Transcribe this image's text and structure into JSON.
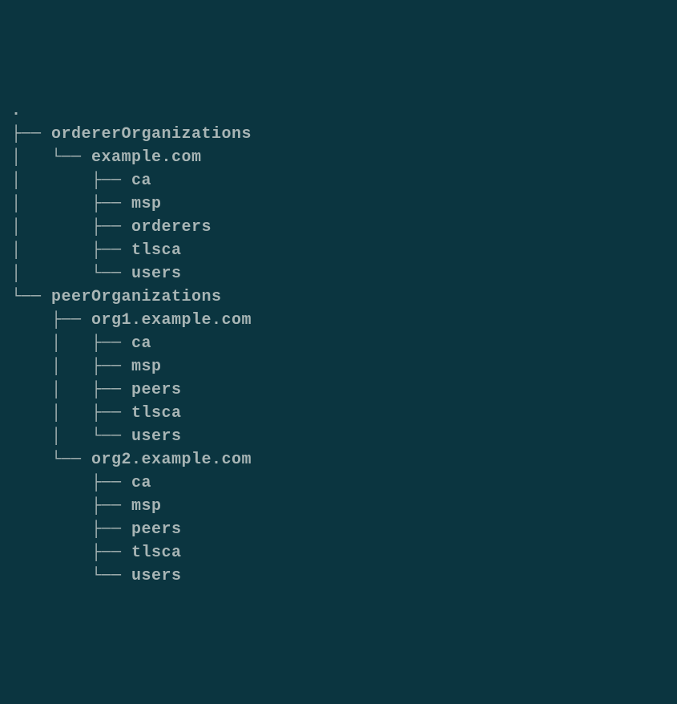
{
  "tree": {
    "root": ".",
    "lines": [
      {
        "prefix": "├── ",
        "name": "ordererOrganizations"
      },
      {
        "prefix": "│   └── ",
        "name": "example.com"
      },
      {
        "prefix": "│       ├── ",
        "name": "ca"
      },
      {
        "prefix": "│       ├── ",
        "name": "msp"
      },
      {
        "prefix": "│       ├── ",
        "name": "orderers"
      },
      {
        "prefix": "│       ├── ",
        "name": "tlsca"
      },
      {
        "prefix": "│       └── ",
        "name": "users"
      },
      {
        "prefix": "└── ",
        "name": "peerOrganizations"
      },
      {
        "prefix": "    ├── ",
        "name": "org1.example.com"
      },
      {
        "prefix": "    │   ├── ",
        "name": "ca"
      },
      {
        "prefix": "    │   ├── ",
        "name": "msp"
      },
      {
        "prefix": "    │   ├── ",
        "name": "peers"
      },
      {
        "prefix": "    │   ├── ",
        "name": "tlsca"
      },
      {
        "prefix": "    │   └── ",
        "name": "users"
      },
      {
        "prefix": "    └── ",
        "name": "org2.example.com"
      },
      {
        "prefix": "        ├── ",
        "name": "ca"
      },
      {
        "prefix": "        ├── ",
        "name": "msp"
      },
      {
        "prefix": "        ├── ",
        "name": "peers"
      },
      {
        "prefix": "        ├── ",
        "name": "tlsca"
      },
      {
        "prefix": "        └── ",
        "name": "users"
      }
    ]
  }
}
